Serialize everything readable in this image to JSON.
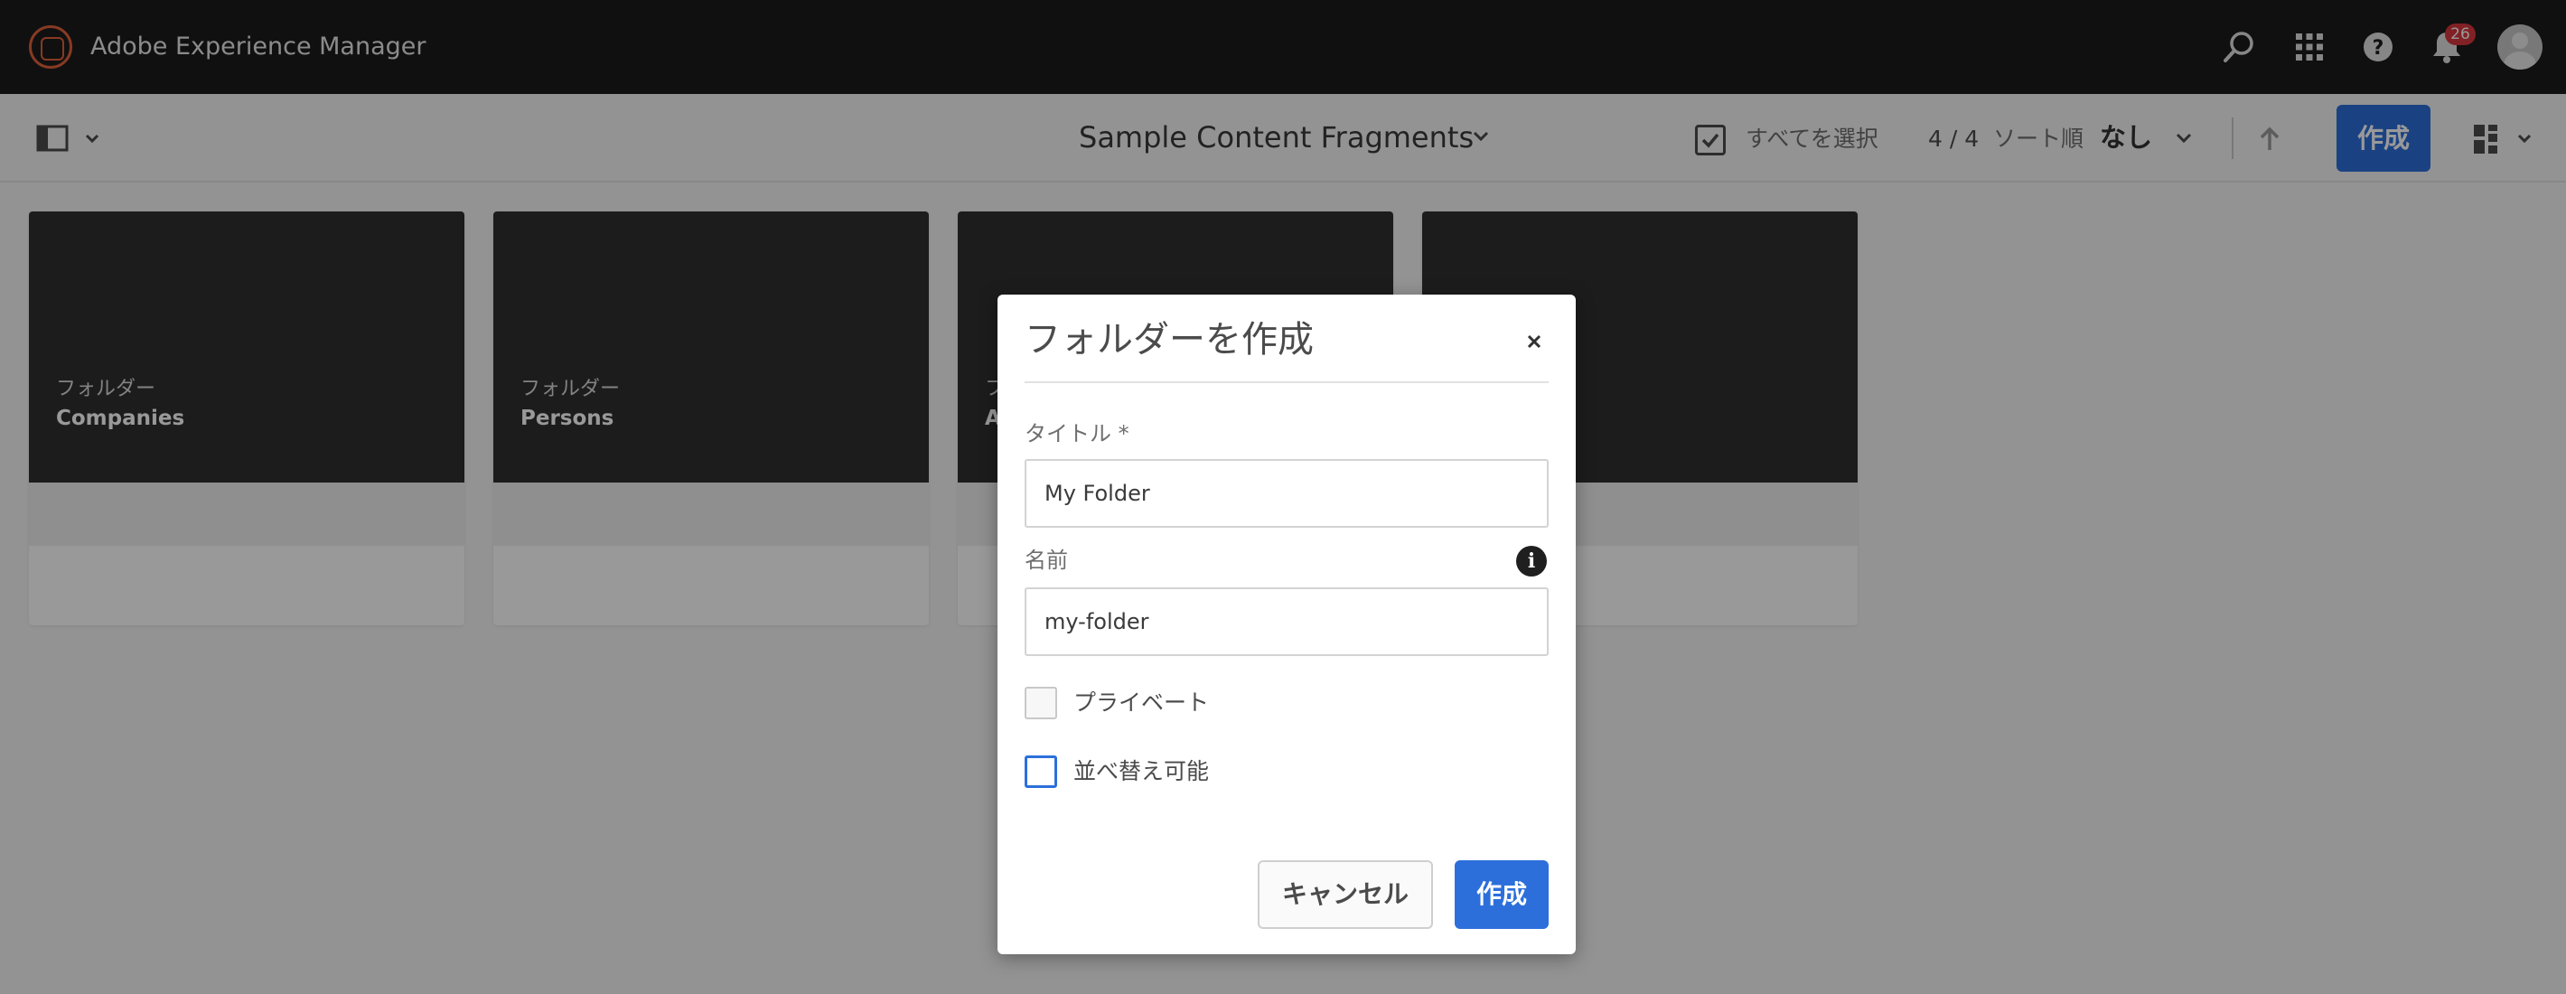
{
  "shell": {
    "app_title": "Adobe Experience Manager",
    "icons": [
      "search-icon",
      "apps-grid-icon",
      "help-icon",
      "bell-icon",
      "avatar"
    ],
    "notification_count": "26",
    "brand_color": "#e2613b"
  },
  "actionbar": {
    "breadcrumb": "Sample Content Fragments",
    "select_all_label": "すべてを選択",
    "count": "4 / 4",
    "sort_label": "ソート順",
    "sort_value": "なし",
    "create_label": "作成",
    "accent_color": "#2c6fdb"
  },
  "cards": [
    {
      "context": "フォルダー",
      "title": "Companies"
    },
    {
      "context": "フォルダー",
      "title": "Persons"
    },
    {
      "context": "フ",
      "title": "A"
    },
    {
      "context": "",
      "title": ""
    }
  ],
  "dialog": {
    "title": "フォルダーを作成",
    "title_field": {
      "label": "タイトル *",
      "value": "My Folder"
    },
    "name_field": {
      "label": "名前",
      "value": "my-folder"
    },
    "private_label": "プライベート",
    "orderable_label": "並べ替え可能",
    "cancel_label": "キャンセル",
    "create_label": "作成"
  }
}
